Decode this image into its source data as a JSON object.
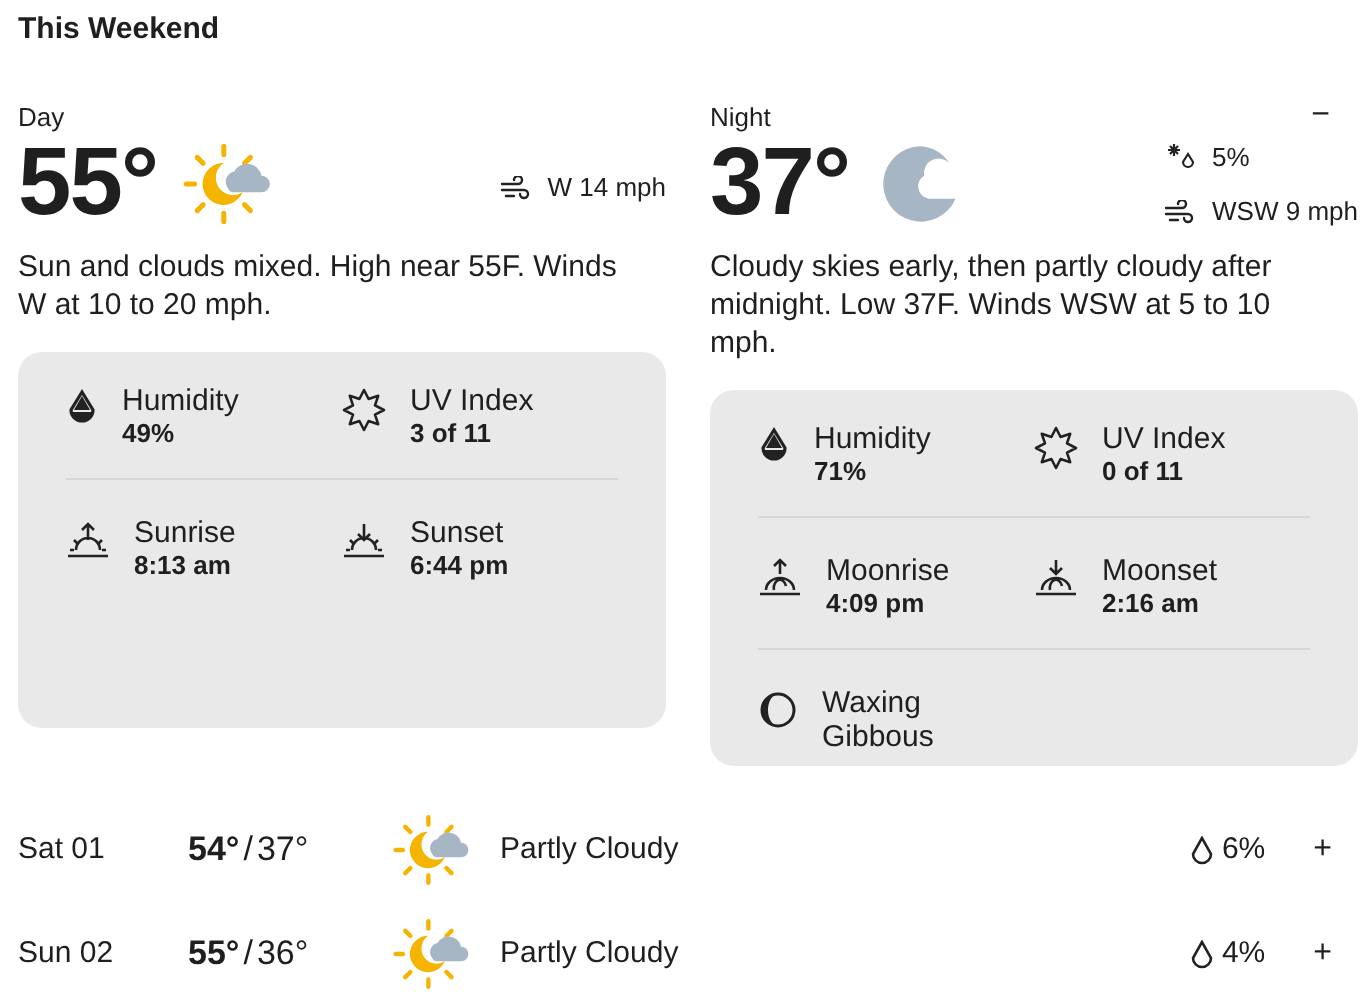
{
  "title": "This Weekend",
  "panels": [
    {
      "kind": "day",
      "label": "Day",
      "temp": "55°",
      "stats": [
        {
          "kind": "wind",
          "text": "W 14 mph"
        }
      ],
      "description": "Sun and clouds mixed. High near 55F. Winds W at 10 to 20 mph.",
      "details": [
        [
          {
            "kind": "humidity",
            "label": "Humidity",
            "value": "49%"
          },
          {
            "kind": "uv",
            "label": "UV Index",
            "value": "3 of 11"
          }
        ],
        [
          {
            "kind": "sunrise",
            "label": "Sunrise",
            "value": "8:13 am"
          },
          {
            "kind": "sunset",
            "label": "Sunset",
            "value": "6:44 pm"
          }
        ]
      ]
    },
    {
      "kind": "night",
      "label": "Night",
      "toggle": "−",
      "temp": "37°",
      "stats": [
        {
          "kind": "precip",
          "text": "5%"
        },
        {
          "kind": "wind",
          "text": "WSW 9 mph"
        }
      ],
      "description": "Cloudy skies early, then partly cloudy after midnight. Low 37F. Winds WSW at 5 to 10 mph.",
      "details": [
        [
          {
            "kind": "humidity",
            "label": "Humidity",
            "value": "71%"
          },
          {
            "kind": "uv",
            "label": "UV Index",
            "value": "0 of 11"
          }
        ],
        [
          {
            "kind": "moonrise",
            "label": "Moonrise",
            "value": "4:09 pm"
          },
          {
            "kind": "moonset",
            "label": "Moonset",
            "value": "2:16 am"
          }
        ],
        [
          {
            "kind": "moonphase",
            "label": "Waxing Gibbous"
          }
        ]
      ]
    }
  ],
  "forecast": [
    {
      "day": "Sat 01",
      "high": "54°",
      "separator": "/",
      "low": "37°",
      "condition": "Partly Cloudy",
      "precip": "6%",
      "toggle": "+"
    },
    {
      "day": "Sun 02",
      "high": "55°",
      "separator": "/",
      "low": "36°",
      "condition": "Partly Cloudy",
      "precip": "4%",
      "toggle": "+"
    }
  ]
}
